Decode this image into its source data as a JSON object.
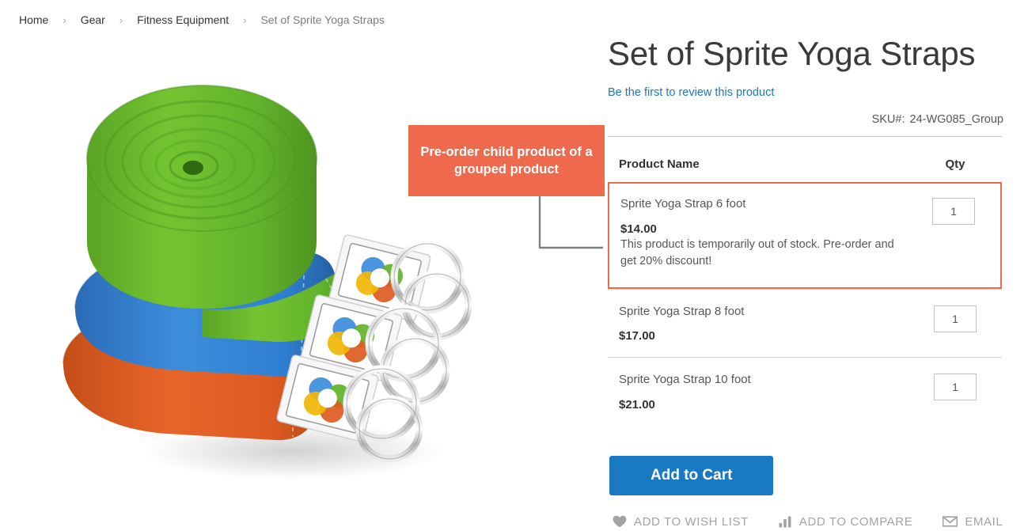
{
  "breadcrumb": {
    "separator": "›",
    "items": [
      {
        "label": "Home",
        "current": false
      },
      {
        "label": "Gear",
        "current": false
      },
      {
        "label": "Fitness Equipment",
        "current": false
      },
      {
        "label": "Set of Sprite Yoga Straps",
        "current": true
      }
    ]
  },
  "product": {
    "title": "Set of Sprite Yoga Straps",
    "review_link": "Be the first to review this product",
    "sku_label": "SKU#:",
    "sku_value": "24-WG085_Group",
    "image_alt": "Set of three rolled yoga straps in green, blue and orange with metal D-rings"
  },
  "grouped_table": {
    "headers": {
      "name": "Product Name",
      "qty": "Qty"
    },
    "rows": [
      {
        "name": "Sprite Yoga Strap 6 foot",
        "price": "$14.00",
        "note": "This product is temporarily out of stock. Pre-order and get 20% discount!",
        "qty": "1",
        "highlighted": true
      },
      {
        "name": "Sprite Yoga Strap 8 foot",
        "price": "$17.00",
        "note": "",
        "qty": "1",
        "highlighted": false
      },
      {
        "name": "Sprite Yoga Strap 10 foot",
        "price": "$21.00",
        "note": "",
        "qty": "1",
        "highlighted": false
      }
    ]
  },
  "cart": {
    "add_to_cart_label": "Add to Cart"
  },
  "actions": [
    {
      "icon": "heart-icon",
      "label": "ADD TO WISH LIST"
    },
    {
      "icon": "bar-chart-icon",
      "label": "ADD TO COMPARE"
    },
    {
      "icon": "envelope-icon",
      "label": "EMAIL"
    }
  ],
  "annotation": {
    "text": "Pre-order child product of a grouped product",
    "background_color": "#EF6A4C",
    "text_color": "#FFFFFF",
    "connector_color": "#808080"
  },
  "colors": {
    "accent_blue": "#1979C3",
    "annotation_orange": "#EF6A4C",
    "text_dark": "#333333",
    "text_muted": "#575757",
    "link_blue": "#1979C3",
    "strap_green": "#62B22B",
    "strap_blue": "#2E7FD1",
    "strap_orange": "#DD5B22"
  }
}
